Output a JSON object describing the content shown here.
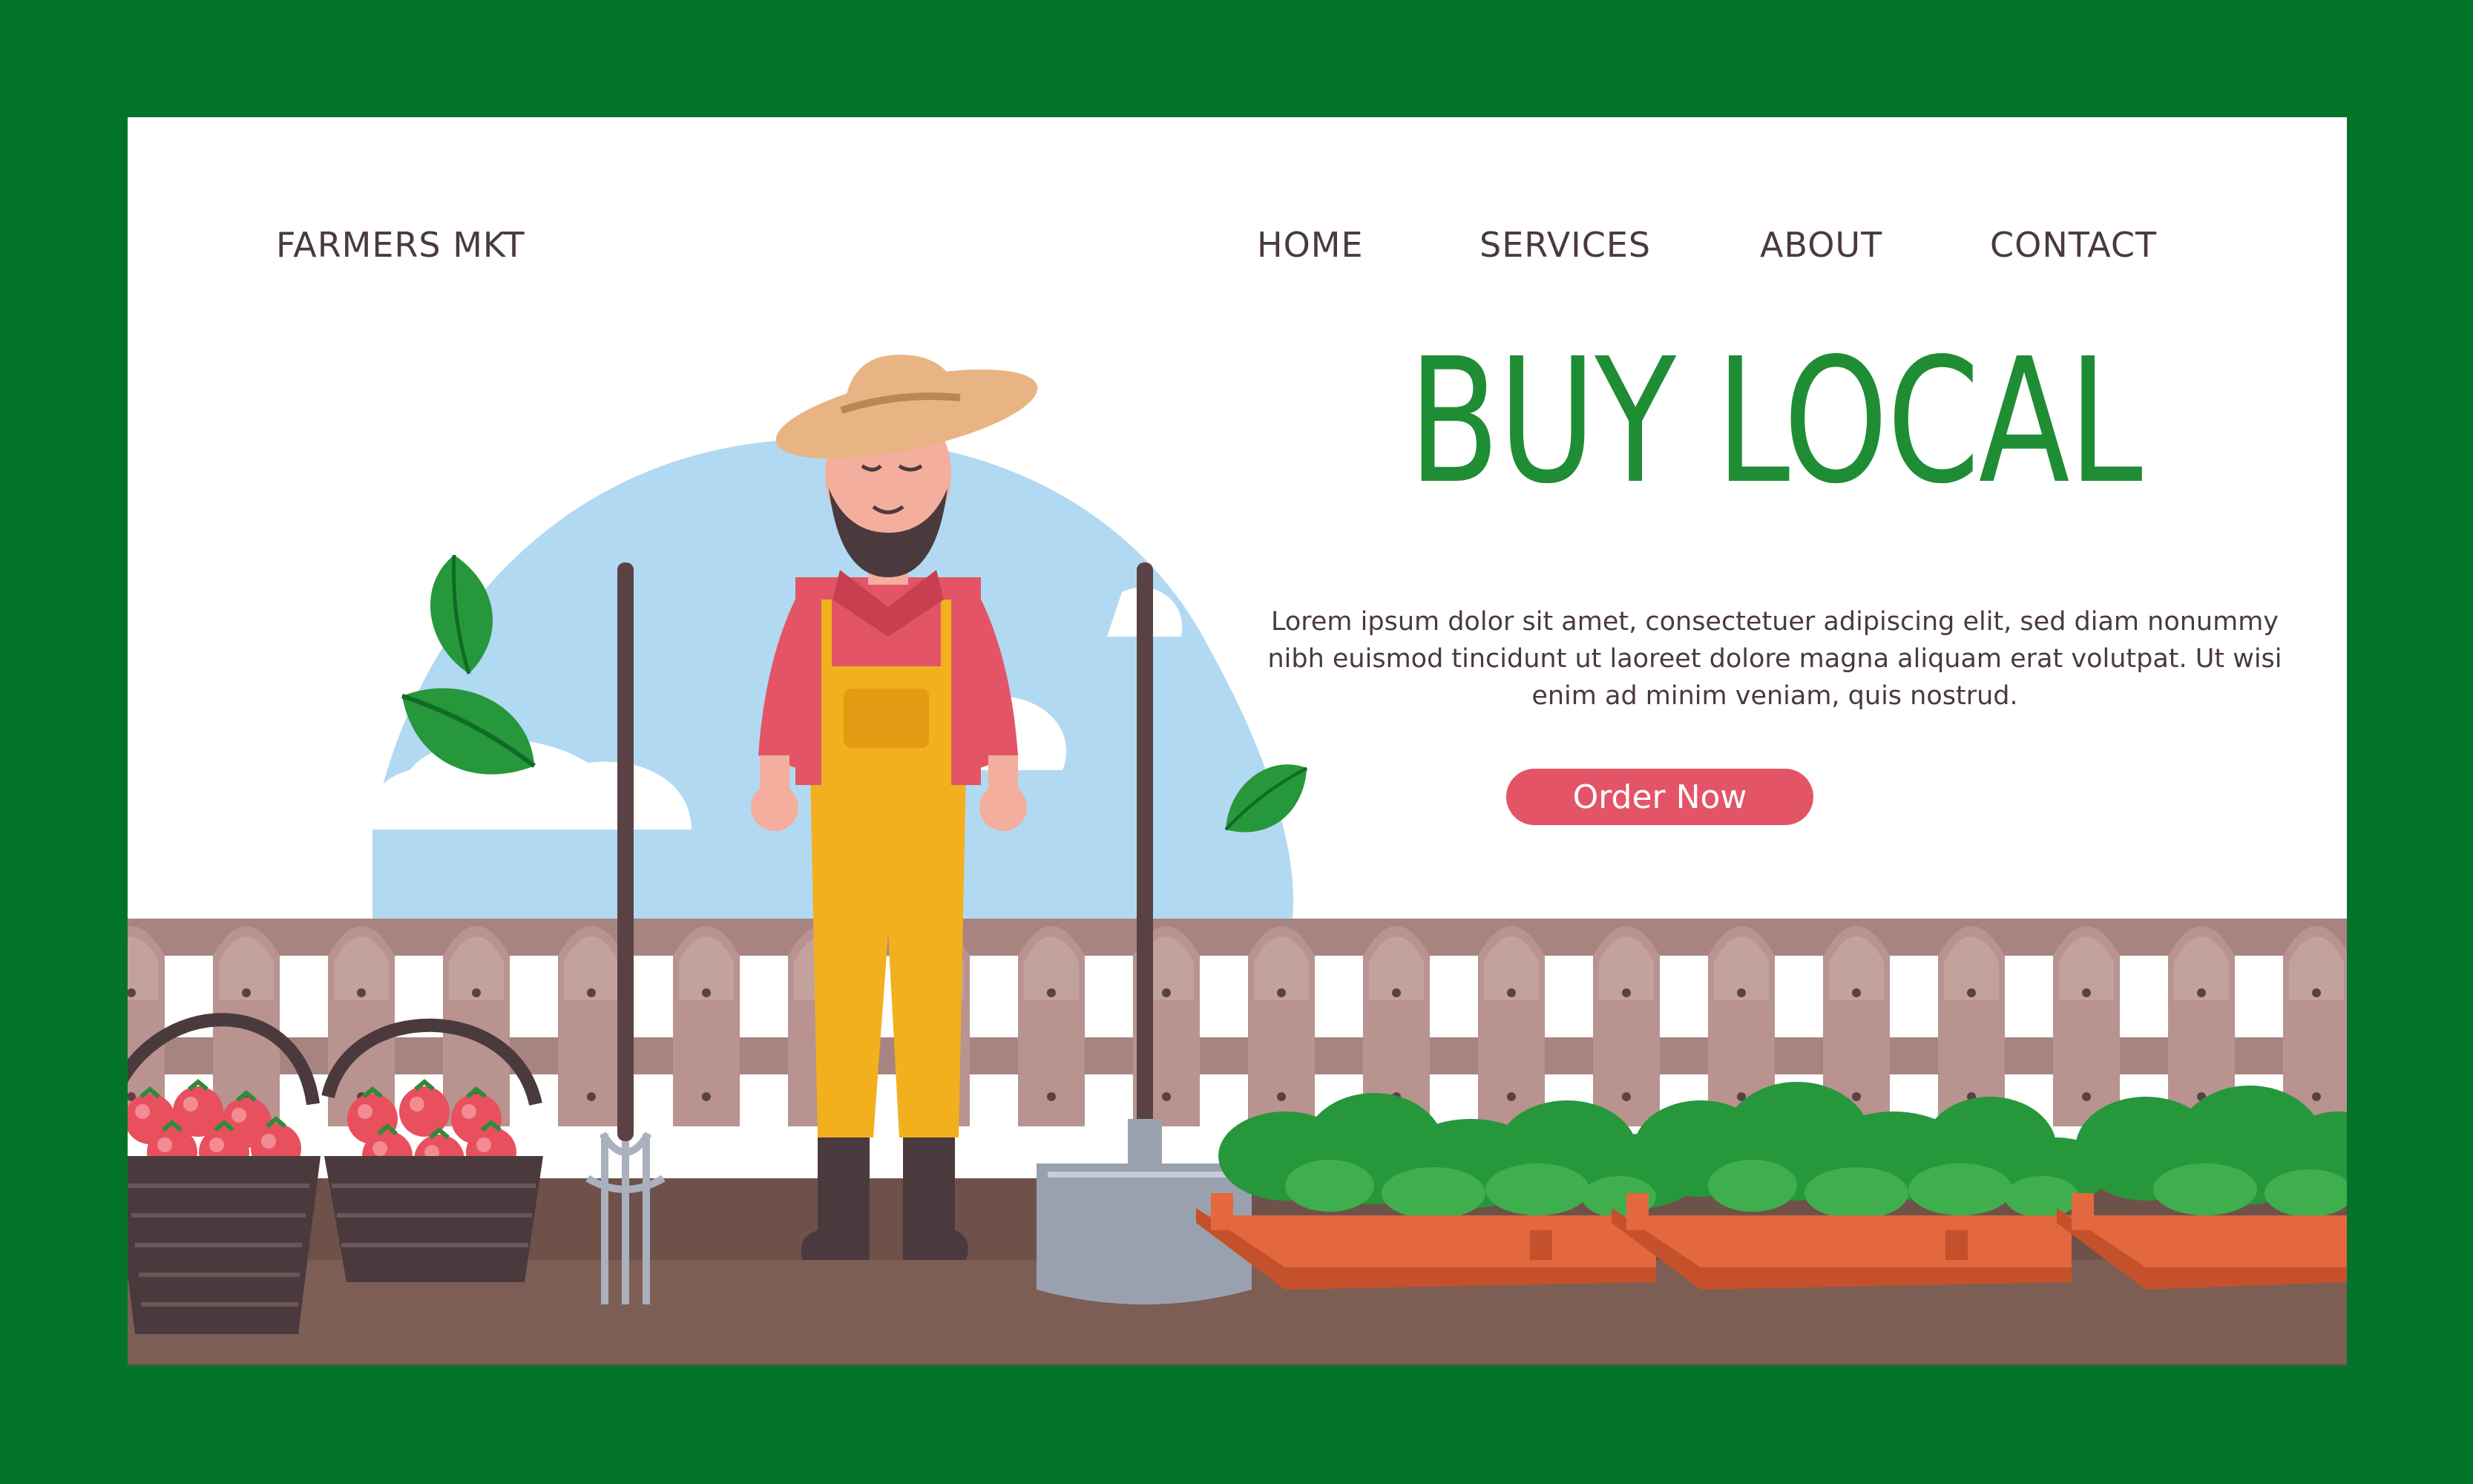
{
  "brand": {
    "name": "FARMERS MKT"
  },
  "nav": {
    "items": [
      {
        "label": "HOME"
      },
      {
        "label": "SERVICES"
      },
      {
        "label": "ABOUT"
      },
      {
        "label": "CONTACT"
      }
    ]
  },
  "hero": {
    "headline": "BUY LOCAL",
    "body": "Lorem ipsum dolor sit amet, consectetuer adipiscing elit, sed diam nonummy nibh euismod tincidunt ut laoreet dolore magna aliquam erat volutpat. Ut wisi enim ad minim veniam, quis nostrud.",
    "cta_label": "Order Now"
  },
  "colors": {
    "frame": "#03742a",
    "headline": "#1f8d34",
    "cta": "#e35566",
    "text": "#4a3a3e",
    "sky": "#b2d9f2",
    "fence": "#b8938f",
    "soil": "#6e524a"
  },
  "icons": [
    "leaf-icon",
    "pitchfork-icon",
    "shovel-icon",
    "basket-icon",
    "tomato-icon",
    "planter-box-icon"
  ]
}
